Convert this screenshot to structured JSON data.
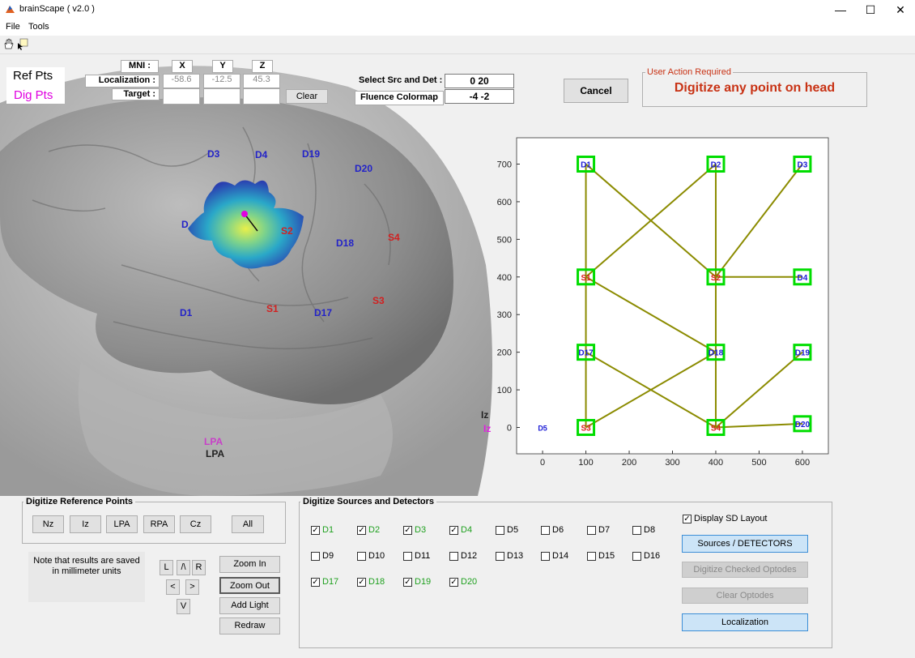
{
  "window": {
    "title": "brainScape  ( v2.0 )",
    "minimize": "—",
    "maximize": "☐",
    "close": "✕"
  },
  "menu": {
    "items": [
      "File",
      "Tools"
    ]
  },
  "toolbar": {
    "icons": [
      "pan-hand-icon",
      "data-cursor-icon"
    ]
  },
  "legend": {
    "ref_pts": "Ref Pts",
    "dig_pts": "Dig Pts"
  },
  "coords": {
    "mni": "MNI :",
    "x": "X",
    "y": "Y",
    "z": "Z",
    "localization_label": "Localization :",
    "target_label": "Target :",
    "loc_x": "-58.6",
    "loc_y": "-12.5",
    "loc_z": "45.3",
    "target_x": "",
    "target_y": "",
    "target_z": "",
    "clear": "Clear"
  },
  "src_det": {
    "label": "Select Src and Det :",
    "value": "0  20"
  },
  "fluence": {
    "label": "Fluence Colormap",
    "value": "-4 -2"
  },
  "cancel": "Cancel",
  "user_action": {
    "title": "User Action Required",
    "message": "Digitize any point on head"
  },
  "brain_labels": {
    "D3": "D3",
    "D4": "D4",
    "D19": "D19",
    "D20": "D20",
    "D2": "D",
    "S2": "S2",
    "D18": "D18",
    "S4": "S4",
    "D1": "D1",
    "S1": "S1",
    "D17": "D17",
    "S3": "S3",
    "Iz_ref": "Iz",
    "Iz_dig": "Iz",
    "LPA_dig": "LPA",
    "LPA_ref": "LPA"
  },
  "chart_data": {
    "type": "scatter",
    "title": "",
    "xlabel": "",
    "ylabel": "",
    "xlim": [
      -60,
      660
    ],
    "ylim": [
      -70,
      770
    ],
    "xticks": [
      0,
      100,
      200,
      300,
      400,
      500,
      600
    ],
    "yticks": [
      0,
      100,
      200,
      300,
      400,
      500,
      600,
      700
    ],
    "points": [
      {
        "name": "D1",
        "x": 100,
        "y": 700,
        "kind": "det"
      },
      {
        "name": "D2",
        "x": 400,
        "y": 700,
        "kind": "det"
      },
      {
        "name": "D3",
        "x": 600,
        "y": 700,
        "kind": "det"
      },
      {
        "name": "S1",
        "x": 100,
        "y": 400,
        "kind": "src"
      },
      {
        "name": "S2",
        "x": 400,
        "y": 400,
        "kind": "src"
      },
      {
        "name": "D4",
        "x": 600,
        "y": 400,
        "kind": "det"
      },
      {
        "name": "D17",
        "x": 100,
        "y": 200,
        "kind": "det"
      },
      {
        "name": "D18",
        "x": 400,
        "y": 200,
        "kind": "det"
      },
      {
        "name": "D19",
        "x": 600,
        "y": 200,
        "kind": "det"
      },
      {
        "name": "S3",
        "x": 100,
        "y": 0,
        "kind": "src"
      },
      {
        "name": "S4",
        "x": 400,
        "y": 0,
        "kind": "src"
      },
      {
        "name": "D20",
        "x": 600,
        "y": 10,
        "kind": "det"
      }
    ],
    "stray_point": {
      "name": "D5",
      "x": 0,
      "y": 0
    },
    "links": [
      [
        "D1",
        "S1"
      ],
      [
        "D1",
        "S2"
      ],
      [
        "D2",
        "S1"
      ],
      [
        "D2",
        "S2"
      ],
      [
        "D3",
        "S2"
      ],
      [
        "S2",
        "D4"
      ],
      [
        "S1",
        "D17"
      ],
      [
        "S1",
        "D18"
      ],
      [
        "S2",
        "D18"
      ],
      [
        "D17",
        "S3"
      ],
      [
        "D17",
        "S4"
      ],
      [
        "D18",
        "S3"
      ],
      [
        "D18",
        "S4"
      ],
      [
        "S4",
        "D19"
      ],
      [
        "S4",
        "D20"
      ]
    ],
    "colors": {
      "link": "#8b8b00",
      "box": "#00dd00",
      "det": "#1a1ad6",
      "src": "#dd1a1a"
    }
  },
  "ref_points": {
    "title": "Digitize Reference Points",
    "buttons": [
      "Nz",
      "Iz",
      "LPA",
      "RPA",
      "Cz",
      "All"
    ]
  },
  "note": "Note that results are saved in millimeter units",
  "nav": {
    "L": "L",
    "up": "/\\",
    "R": "R",
    "left": "<",
    "right": ">",
    "down": "V"
  },
  "view_buttons": [
    "Zoom In",
    "Zoom Out",
    "Add Light",
    "Redraw"
  ],
  "sd_panel": {
    "title": "Digitize Sources and Detectors",
    "rows": [
      [
        {
          "label": "D1",
          "checked": true
        },
        {
          "label": "D2",
          "checked": true
        },
        {
          "label": "D3",
          "checked": true
        },
        {
          "label": "D4",
          "checked": true
        },
        {
          "label": "D5",
          "checked": false
        },
        {
          "label": "D6",
          "checked": false
        },
        {
          "label": "D7",
          "checked": false
        },
        {
          "label": "D8",
          "checked": false
        }
      ],
      [
        {
          "label": "D9",
          "checked": false
        },
        {
          "label": "D10",
          "checked": false
        },
        {
          "label": "D11",
          "checked": false
        },
        {
          "label": "D12",
          "checked": false
        },
        {
          "label": "D13",
          "checked": false
        },
        {
          "label": "D14",
          "checked": false
        },
        {
          "label": "D15",
          "checked": false
        },
        {
          "label": "D16",
          "checked": false
        }
      ],
      [
        {
          "label": "D17",
          "checked": true
        },
        {
          "label": "D18",
          "checked": true
        },
        {
          "label": "D19",
          "checked": true
        },
        {
          "label": "D20",
          "checked": true
        }
      ]
    ],
    "display_layout": "Display SD Layout",
    "sources_detectors": "Sources / DETECTORS",
    "digitize_checked": "Digitize Checked Optodes",
    "clear_optodes": "Clear Optodes",
    "localization": "Localization"
  }
}
